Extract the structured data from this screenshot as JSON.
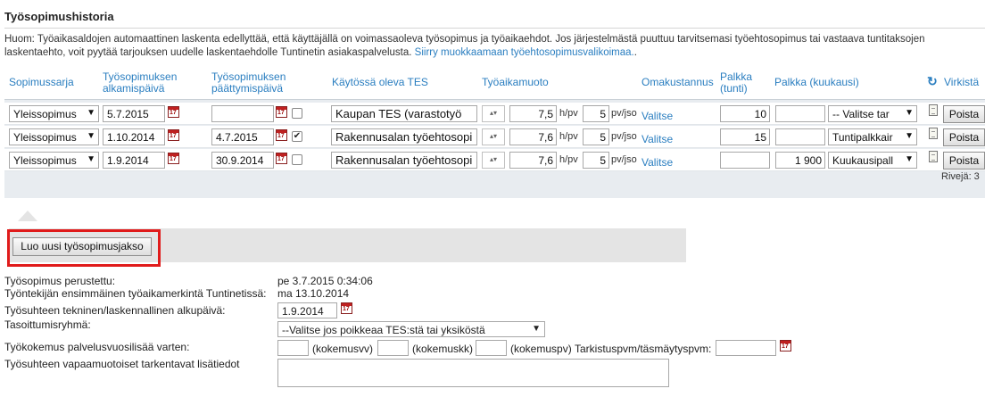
{
  "page": {
    "title": "Työsopimushistoria",
    "note_text": "Huom: Työaikasaldojen automaattinen laskenta edellyttää, että käyttäjällä on voimassaoleva työsopimus ja työaikaehdot. Jos järjestelmästä puuttuu tarvitsemasi työehtosopimus tai vastaava tuntitaksojen",
    "note_text2": "laskentaehto, voit pyytää tarjouksen uudelle laskentaehdolle Tuntinetin asiakaspalvelusta.",
    "note_link": "Siirry muokkaamaan työehtosopimusvalikoimaa.",
    "note_end": "."
  },
  "table": {
    "headers": {
      "sopimussarja": "Sopimussarja",
      "alku1": "Työsopimuksen",
      "alku2": "alkamispäivä",
      "loppu1": "Työsopimuksen",
      "loppu2": "päättymispäivä",
      "tes": "Käytössä oleva TES",
      "tyoaikamuoto": "Työaikamuoto",
      "omakustannus": "Omakustannus",
      "palkka_tunti1": "Palkka",
      "palkka_tunti2": "(tunti)",
      "palkka_kk": "Palkka (kuukausi)",
      "virkistys": "Virkistä"
    },
    "rows": [
      {
        "sarja": "Yleissopimus",
        "start": "5.7.2015",
        "end": "",
        "end_checked": false,
        "tes": "Kaupan TES (varastotyö",
        "hours_per_day": "7,5",
        "days_per_week": "5",
        "link": "Valitse",
        "hourly": "10",
        "monthly": "",
        "pay_type": "-- Valitse tar",
        "remove": "Poista"
      },
      {
        "sarja": "Yleissopimus",
        "start": "1.10.2014",
        "end": "4.7.2015",
        "end_checked": true,
        "tes": "Rakennusalan työehtosopi",
        "hours_per_day": "7,6",
        "days_per_week": "5",
        "link": "Valitse",
        "hourly": "15",
        "monthly": "",
        "pay_type": "Tuntipalkkair",
        "remove": "Poista"
      },
      {
        "sarja": "Yleissopimus",
        "start": "1.9.2014",
        "end": "30.9.2014",
        "end_checked": false,
        "tes": "Rakennusalan työehtosopi",
        "hours_per_day": "7,6",
        "days_per_week": "5",
        "link": "Valitse",
        "hourly": "",
        "monthly": "1 900",
        "pay_type": "Kuukausipall",
        "remove": "Poista"
      }
    ],
    "units": {
      "per_day": "h/pv",
      "per_week": "pv/jso"
    },
    "rows_count_label": "Rivejä: 3",
    "calendar_glyph": "17"
  },
  "new_period": {
    "button_label": "Luo uusi työsopimusjakso"
  },
  "details": {
    "created_label": "Työsopimus perustettu:",
    "created_value": "pe 3.7.2015 0:34:06",
    "first_entry_label": "Työntekijän ensimmäinen työaikamerkintä Tuntinetissä:",
    "first_entry_value": "ma 13.10.2014",
    "start_date_label": "Työsuhteen tekninen/laskennallinen alkupäivä:",
    "start_date_value": "1.9.2014",
    "group_label": "Tasoittumisryhmä:",
    "group_value": "--Valitse jos poikkeaa TES:stä tai yksiköstä",
    "experience_label": "Työkokemus palvelusvuosilisää varten:",
    "years_label": "(kokemusvv)",
    "months_label": "(kokemuskk)",
    "days_label": "(kokemuspv)",
    "check_date_label": "Tarkistuspvm/täsmäytyspvm:",
    "free_text_label": "Työsuhteen vapaamuotoiset tarkentavat lisätiedot"
  },
  "colors": {
    "accent": "#2a7ec0",
    "highlight": "#e01b1b",
    "grid_bg": "#e8ecf0"
  }
}
